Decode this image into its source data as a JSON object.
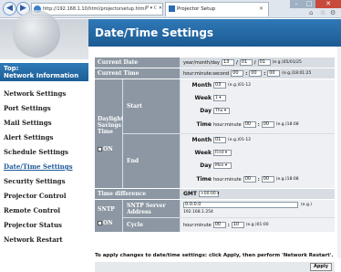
{
  "browser": {
    "address": "http://192.168.1.10/html/projectorsetup.html",
    "address_controls": "P ▾ ℂ ✕",
    "tab_title": "Projector Setup",
    "tab_close": "×",
    "back_glyph": "◀",
    "forward_glyph": "▶",
    "min_glyph": "–",
    "max_glyph": "□",
    "close_glyph": "✕",
    "home_glyph": "⌂",
    "star_glyph": "☆",
    "gear_glyph": "⚙"
  },
  "sidebar": {
    "top_line1": "Top:",
    "top_line2": "Network Information",
    "items": [
      {
        "label": "Network Settings"
      },
      {
        "label": "Port Settings"
      },
      {
        "label": "Mail Settings"
      },
      {
        "label": "Alert Settings"
      },
      {
        "label": "Schedule Settings"
      },
      {
        "label": "Date/Time Settings"
      },
      {
        "label": "Security Settings"
      },
      {
        "label": "Projector Control"
      },
      {
        "label": "Remote Control"
      },
      {
        "label": "Projector Status"
      },
      {
        "label": "Network Restart"
      }
    ]
  },
  "page": {
    "title": "Date/Time Settings"
  },
  "form": {
    "current_date": {
      "label": "Current Date",
      "prefix": "year/month/day",
      "year": "13",
      "month": "01",
      "day": "01",
      "sep": "/",
      "hint": "(e.g.)05/01/25"
    },
    "current_time": {
      "label": "Current Time",
      "prefix": "hour:minute:second",
      "hour": "00",
      "minute": "00",
      "second": "00",
      "sep": ":",
      "hint": "(e.g.)18:01:25"
    },
    "dst": {
      "label_line1": "Daylight",
      "label_line2": "Savings",
      "label_line3": "Time",
      "on_label": "ON",
      "start": {
        "label": "Start",
        "month_label": "Month",
        "month": "03",
        "month_hint": "(e.g.)01-12",
        "week_label": "Week",
        "week": "1",
        "day_label": "Day",
        "day": "Thu",
        "time_label": "Time",
        "time_prefix": "hour:minute",
        "hour": "00",
        "minute": "00",
        "time_hint": "(e.g.)18:08"
      },
      "end": {
        "label": "End",
        "month_label": "Month",
        "month": "01",
        "month_hint": "(e.g.)01-12",
        "week_label": "Week",
        "week": "First",
        "day_label": "Day",
        "day": "Mon",
        "time_label": "Time",
        "time_prefix": "hour:minute",
        "hour": "00",
        "minute": "00",
        "time_hint": "(e.g.)18:08"
      }
    },
    "time_difference": {
      "label": "Time difference",
      "gmt_label": "GMT",
      "value": "+00:00"
    },
    "sntp": {
      "label": "SNTP",
      "on_label": "ON",
      "server_label": "SNTP Server Address",
      "server_value": "0.0.0.0",
      "server_hint": "(e.g.)",
      "server_example": "192.168.1.254",
      "cycle_label": "Cycle",
      "cycle_prefix": "hour:minute",
      "cycle_hour": "00",
      "cycle_minute": "10",
      "cycle_hint": "(e.g.)01:00"
    }
  },
  "notice": "To apply changes to date/time settings: click Apply, then perform 'Network Restart'.",
  "apply_label": "Apply"
}
